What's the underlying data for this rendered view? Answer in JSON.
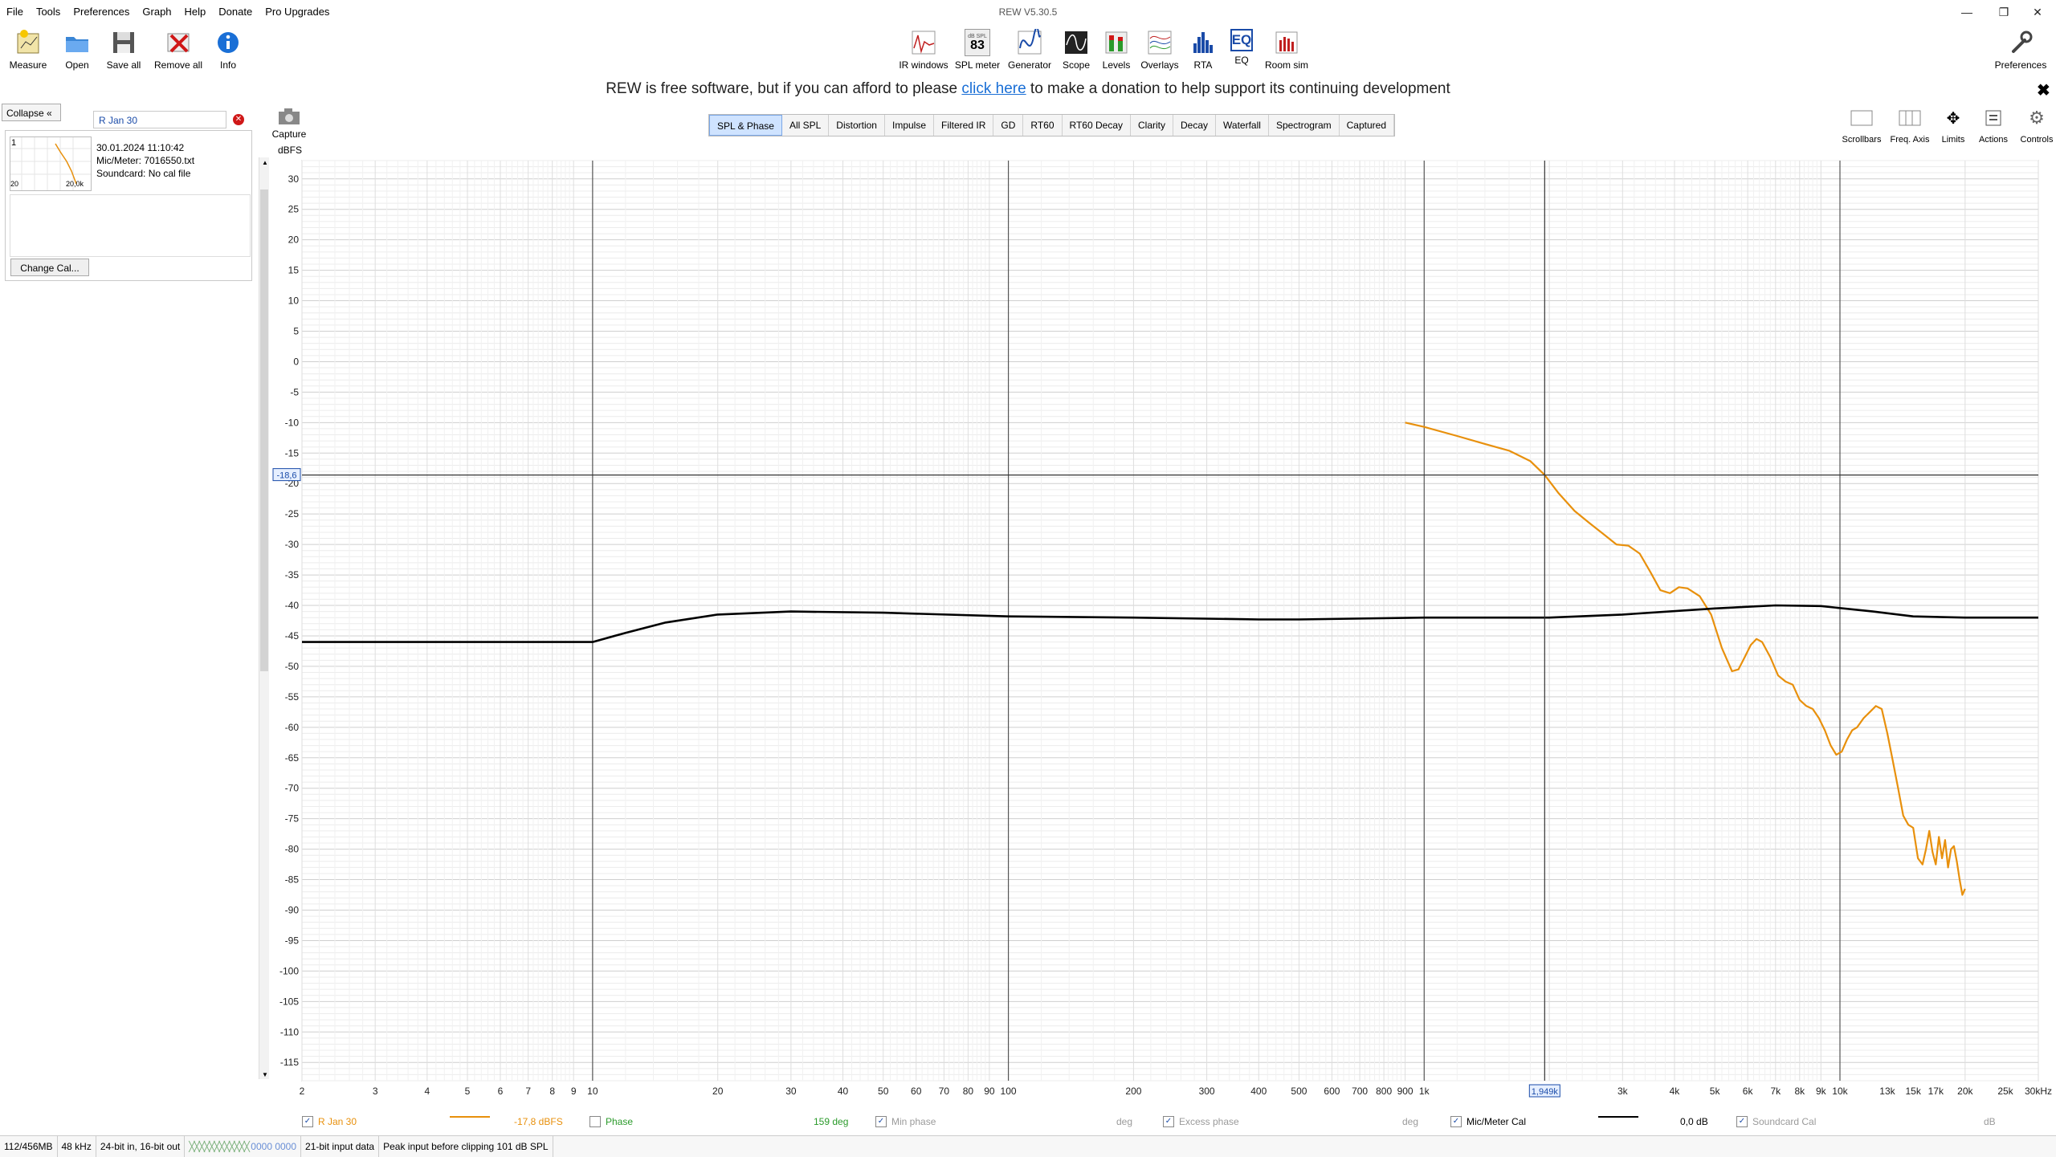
{
  "app": {
    "title": "REW V5.30.5"
  },
  "menu": [
    "File",
    "Tools",
    "Preferences",
    "Graph",
    "Help",
    "Donate",
    "Pro Upgrades"
  ],
  "toolbar_left": [
    {
      "label": "Measure",
      "icon": "measure-icon"
    },
    {
      "label": "Open",
      "icon": "open-folder-icon"
    },
    {
      "label": "Save all",
      "icon": "save-icon"
    },
    {
      "label": "Remove all",
      "icon": "remove-icon"
    },
    {
      "label": "Info",
      "icon": "info-icon"
    }
  ],
  "toolbar_center": [
    {
      "label": "IR windows",
      "icon": "ir-windows-icon"
    },
    {
      "label": "SPL meter",
      "icon": "spl-meter-icon",
      "badge_top": "dB SPL",
      "badge": "83"
    },
    {
      "label": "Generator",
      "icon": "generator-icon"
    },
    {
      "label": "Scope",
      "icon": "scope-icon"
    },
    {
      "label": "Levels",
      "icon": "levels-icon"
    },
    {
      "label": "Overlays",
      "icon": "overlays-icon"
    },
    {
      "label": "RTA",
      "icon": "rta-icon"
    },
    {
      "label": "EQ",
      "icon": "eq-icon",
      "badge": "EQ"
    },
    {
      "label": "Room sim",
      "icon": "room-sim-icon"
    }
  ],
  "preferences_label": "Preferences",
  "donation": {
    "pre": "REW is free software, but if you can afford to please ",
    "link": "click here",
    "post": " to make a donation to help support its continuing development",
    "close": "✖"
  },
  "measurements": {
    "collapse_label": "Collapse",
    "selected_name": "R Jan 30",
    "items": [
      {
        "index": "1",
        "date": "30.01.2024 11:10:42",
        "mic": "Mic/Meter: 7016550.txt",
        "soundcard": "Soundcard: No cal file",
        "thumb_min": "20",
        "thumb_max": "20,0k"
      }
    ],
    "change_cal_label": "Change Cal..."
  },
  "capture_label": "Capture",
  "tabs": [
    "SPL & Phase",
    "All SPL",
    "Distortion",
    "Impulse",
    "Filtered IR",
    "GD",
    "RT60",
    "RT60 Decay",
    "Clarity",
    "Decay",
    "Waterfall",
    "Spectrogram",
    "Captured"
  ],
  "active_tab": "SPL & Phase",
  "right_tools": [
    {
      "label": "Scrollbars",
      "icon": "scrollbars-icon"
    },
    {
      "label": "Freq. Axis",
      "icon": "freq-axis-icon"
    },
    {
      "label": "Limits",
      "icon": "limits-icon"
    },
    {
      "label": "Actions",
      "icon": "actions-icon"
    },
    {
      "label": "Controls",
      "icon": "controls-icon"
    }
  ],
  "chart_data": {
    "type": "line",
    "ylabel": "dBFS",
    "xscale": "log",
    "ylim": [
      -118,
      33
    ],
    "xlim": [
      2,
      30000
    ],
    "y_ticks": [
      30,
      25,
      20,
      15,
      10,
      5,
      0,
      -5,
      -10,
      -15,
      -20,
      -25,
      -30,
      -35,
      -40,
      -45,
      -50,
      -55,
      -60,
      -65,
      -70,
      -75,
      -80,
      -85,
      -90,
      -95,
      -100,
      -105,
      -110,
      -115
    ],
    "x_ticks": [
      {
        "v": 2,
        "label": "2"
      },
      {
        "v": 3,
        "label": "3"
      },
      {
        "v": 4,
        "label": "4"
      },
      {
        "v": 5,
        "label": "5"
      },
      {
        "v": 6,
        "label": "6"
      },
      {
        "v": 7,
        "label": "7"
      },
      {
        "v": 8,
        "label": "8"
      },
      {
        "v": 9,
        "label": "9"
      },
      {
        "v": 10,
        "label": "10"
      },
      {
        "v": 20,
        "label": "20"
      },
      {
        "v": 30,
        "label": "30"
      },
      {
        "v": 40,
        "label": "40"
      },
      {
        "v": 50,
        "label": "50"
      },
      {
        "v": 60,
        "label": "60"
      },
      {
        "v": 70,
        "label": "70"
      },
      {
        "v": 80,
        "label": "80"
      },
      {
        "v": 90,
        "label": "90"
      },
      {
        "v": 100,
        "label": "100"
      },
      {
        "v": 200,
        "label": "200"
      },
      {
        "v": 300,
        "label": "300"
      },
      {
        "v": 400,
        "label": "400"
      },
      {
        "v": 500,
        "label": "500"
      },
      {
        "v": 600,
        "label": "600"
      },
      {
        "v": 700,
        "label": "700"
      },
      {
        "v": 800,
        "label": "800"
      },
      {
        "v": 900,
        "label": "900"
      },
      {
        "v": 1000,
        "label": "1k"
      },
      {
        "v": 3000,
        "label": "3k"
      },
      {
        "v": 4000,
        "label": "4k"
      },
      {
        "v": 5000,
        "label": "5k"
      },
      {
        "v": 6000,
        "label": "6k"
      },
      {
        "v": 7000,
        "label": "7k"
      },
      {
        "v": 8000,
        "label": "8k"
      },
      {
        "v": 9000,
        "label": "9k"
      },
      {
        "v": 10000,
        "label": "10k"
      },
      {
        "v": 13000,
        "label": "13k"
      },
      {
        "v": 15000,
        "label": "15k"
      },
      {
        "v": 17000,
        "label": "17k"
      },
      {
        "v": 20000,
        "label": "20k"
      },
      {
        "v": 25000,
        "label": "25k"
      },
      {
        "v": 30000,
        "label": "30kHz"
      }
    ],
    "cursor": {
      "freq": 1949,
      "freq_label": "1,949k",
      "level": -18.6,
      "level_label": "-18,6"
    },
    "series": [
      {
        "name": "R Jan 30",
        "color": "#e8900c",
        "x": [
          900,
          1000,
          1200,
          1400,
          1600,
          1800,
          1949,
          2100,
          2300,
          2500,
          2700,
          2900,
          3100,
          3300,
          3500,
          3700,
          3900,
          4100,
          4300,
          4600,
          4900,
          5200,
          5500,
          5700,
          5900,
          6100,
          6300,
          6500,
          6800,
          7100,
          7400,
          7700,
          8000,
          8300,
          8600,
          8900,
          9200,
          9500,
          9800,
          10100,
          10400,
          10700,
          11000,
          11400,
          11800,
          12200,
          12600,
          13000,
          13400,
          13800,
          14200,
          14600,
          15000,
          15400,
          15800,
          16100,
          16400,
          16700,
          17000,
          17300,
          17600,
          17900,
          18200,
          18500,
          18800,
          19100,
          19400,
          19700,
          20000
        ],
        "y": [
          -10,
          -10.7,
          -12.2,
          -13.5,
          -14.6,
          -16.3,
          -18.6,
          -21.5,
          -24.5,
          -26.5,
          -28.3,
          -30.0,
          -30.2,
          -31.5,
          -34.5,
          -37.5,
          -38.0,
          -37.0,
          -37.2,
          -38.5,
          -41.5,
          -47.0,
          -50.8,
          -50.5,
          -48.5,
          -46.5,
          -45.5,
          -46.0,
          -48.5,
          -51.5,
          -52.5,
          -53.0,
          -55.5,
          -56.5,
          -57.0,
          -58.5,
          -60.5,
          -63.0,
          -64.5,
          -64.0,
          -62.0,
          -60.5,
          -60.0,
          -58.5,
          -57.5,
          -56.5,
          -57.0,
          -61.0,
          -65.5,
          -70.0,
          -74.5,
          -76.0,
          -76.5,
          -81.5,
          -82.5,
          -80.0,
          -77.0,
          -80.5,
          -82.5,
          -78.0,
          -81.5,
          -78.5,
          -83.0,
          -80.0,
          -79.5,
          -82.0,
          -85.0,
          -87.5,
          -86.5
        ]
      },
      {
        "name": "Mic/Meter Cal",
        "color": "#000000",
        "x": [
          2,
          5,
          10,
          12,
          15,
          20,
          30,
          50,
          100,
          200,
          400,
          500,
          1000,
          2000,
          3000,
          5000,
          7000,
          9000,
          12000,
          15000,
          20000,
          30000
        ],
        "y": [
          -46.0,
          -46.0,
          -46.0,
          -44.5,
          -42.8,
          -41.5,
          -41.0,
          -41.2,
          -41.8,
          -42.0,
          -42.3,
          -42.3,
          -42.0,
          -42.0,
          -41.5,
          -40.5,
          -40.0,
          -40.1,
          -41.0,
          -41.8,
          -42.0,
          -42.0
        ]
      }
    ]
  },
  "legend": {
    "series1": {
      "name": "R Jan 30",
      "value": "-17,8 dBFS"
    },
    "phase": {
      "name": "Phase",
      "value": "159 deg"
    },
    "min_phase": {
      "name": "Min phase",
      "unit": "deg"
    },
    "excess_phase": {
      "name": "Excess phase",
      "unit": "deg"
    },
    "mic_cal": {
      "name": "Mic/Meter Cal",
      "value": "0,0 dB"
    },
    "soundcard_cal": {
      "name": "Soundcard Cal",
      "unit": "dB"
    }
  },
  "status": [
    "112/456MB",
    "48 kHz",
    "24-bit in, 16-bit out",
    "0000 0000",
    "21-bit input data",
    "Peak input before clipping 101 dB SPL"
  ],
  "colors": {
    "accent": "#1a6fd6",
    "series1": "#e8900c",
    "phase": "#2a9a2a"
  }
}
